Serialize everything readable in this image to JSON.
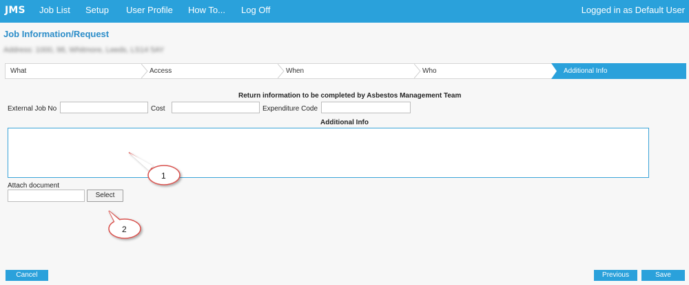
{
  "nav": {
    "brand": "JMS",
    "items": [
      "Job List",
      "Setup",
      "User Profile",
      "How To...",
      "Log Off"
    ],
    "logged_in": "Logged in as Default User"
  },
  "page": {
    "title": "Job Information/Request",
    "address": "Address: 1000, 98, Whitmore, Leeds, LS14 5AY"
  },
  "wizard": {
    "steps": [
      "What",
      "Access",
      "When",
      "Who",
      "Additional Info"
    ],
    "active_step": "Additional Info"
  },
  "form": {
    "return_heading": "Return information to be completed by Asbestos Management Team",
    "external_job_label": "External Job No",
    "external_job_value": "",
    "cost_label": "Cost",
    "cost_value": "",
    "expenditure_label": "Expenditure Code",
    "expenditure_value": "",
    "additional_info_heading": "Additional Info",
    "additional_info_value": "",
    "attach_label": "Attach document",
    "attach_value": "",
    "select_label": "Select"
  },
  "callouts": [
    "1",
    "2"
  ],
  "footer": {
    "cancel_label": "Cancel",
    "previous_label": "Previous",
    "save_label": "Save"
  },
  "colors": {
    "accent": "#2aa1db",
    "title": "#2a8cc8",
    "callout_stroke": "#d9534f"
  }
}
